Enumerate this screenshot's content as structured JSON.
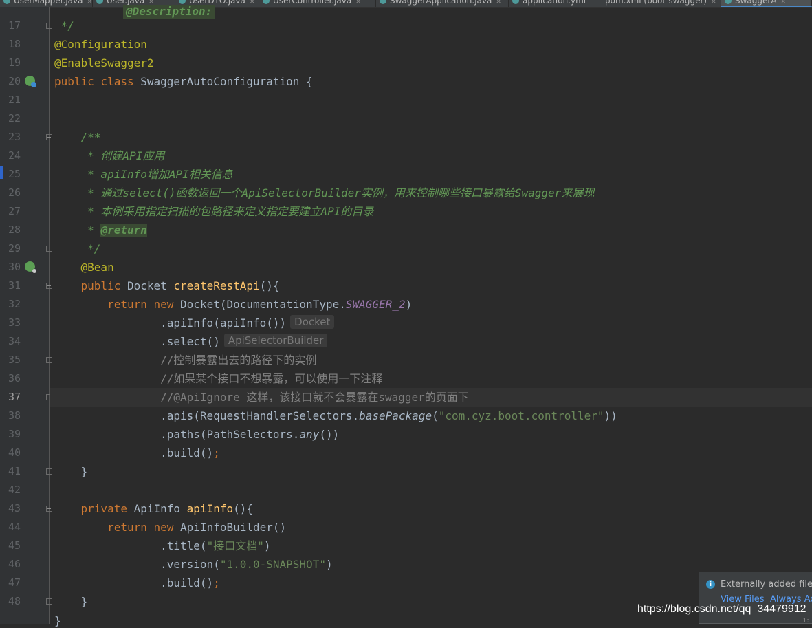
{
  "tabs": [
    {
      "label": "UserMapper.java",
      "icon": "java-class-icon"
    },
    {
      "label": "User.java",
      "icon": "java-class-icon"
    },
    {
      "label": "UserDTO.java",
      "icon": "java-class-icon"
    },
    {
      "label": "UserController.java",
      "icon": "java-class-icon"
    },
    {
      "label": "SwaggerApplication.java",
      "icon": "java-class-icon"
    },
    {
      "label": "application.yml",
      "icon": "yml-file-icon"
    },
    {
      "label": "pom.xml (boot-swagger)",
      "icon": "maven-icon"
    },
    {
      "label": "SwaggerA",
      "icon": "java-class-icon",
      "active": true
    }
  ],
  "top_partial_text": "@Description:",
  "current_line": 37,
  "lines": [
    {
      "n": "17",
      "fold": "end",
      "tokens": [
        {
          "t": " */",
          "c": "c"
        }
      ]
    },
    {
      "n": "18",
      "tokens": [
        {
          "t": "@Configuration",
          "c": "a"
        }
      ]
    },
    {
      "n": "19",
      "tokens": [
        {
          "t": "@EnableSwagger2",
          "c": "a"
        }
      ]
    },
    {
      "n": "20",
      "icon": "spring-config-icon",
      "tokens": [
        {
          "t": "public class ",
          "c": "k"
        },
        {
          "t": "SwaggerAutoConfiguration {"
        }
      ]
    },
    {
      "n": "21",
      "tokens": []
    },
    {
      "n": "22",
      "tokens": []
    },
    {
      "n": "23",
      "fold": "start",
      "tokens": [
        {
          "t": "    /**",
          "c": "c"
        }
      ]
    },
    {
      "n": "24",
      "tokens": [
        {
          "t": "     * 创建API应用",
          "c": "c"
        }
      ]
    },
    {
      "n": "25",
      "tokens": [
        {
          "t": "     * apiInfo增加API相关信息",
          "c": "c"
        }
      ]
    },
    {
      "n": "26",
      "tokens": [
        {
          "t": "     * 通过select()函数返回一个ApiSelectorBuilder实例，用来控制哪些接口暴露给Swagger来展现",
          "c": "c"
        }
      ]
    },
    {
      "n": "27",
      "tokens": [
        {
          "t": "     * 本例采用指定扫描的包路径来定义指定要建立API的目录",
          "c": "c"
        }
      ]
    },
    {
      "n": "28",
      "tokens": [
        {
          "t": "     * ",
          "c": "c"
        },
        {
          "t": "@return",
          "c": "ctag"
        }
      ]
    },
    {
      "n": "29",
      "fold": "end",
      "tokens": [
        {
          "t": "     */",
          "c": "c"
        }
      ]
    },
    {
      "n": "30",
      "icon": "spring-bean-icon",
      "tokens": [
        {
          "t": "    "
        },
        {
          "t": "@Bean",
          "c": "a"
        }
      ]
    },
    {
      "n": "31",
      "fold": "start",
      "tokens": [
        {
          "t": "    "
        },
        {
          "t": "public ",
          "c": "k"
        },
        {
          "t": "Docket "
        },
        {
          "t": "createRestApi",
          "c": "f"
        },
        {
          "t": "(){"
        }
      ]
    },
    {
      "n": "32",
      "tokens": [
        {
          "t": "        "
        },
        {
          "t": "return new ",
          "c": "k"
        },
        {
          "t": "Docket(DocumentationType."
        },
        {
          "t": "SWAGGER_2",
          "c": "sf"
        },
        {
          "t": ")"
        }
      ]
    },
    {
      "n": "33",
      "tokens": [
        {
          "t": "                .apiInfo(apiInfo())"
        },
        {
          "t": "Docket",
          "c": "hint"
        }
      ]
    },
    {
      "n": "34",
      "tokens": [
        {
          "t": "                .select()"
        },
        {
          "t": "ApiSelectorBuilder",
          "c": "hint"
        }
      ]
    },
    {
      "n": "35",
      "fold": "start",
      "tokens": [
        {
          "t": "                //控制暴露出去的路径下的实例",
          "c": "ln"
        }
      ]
    },
    {
      "n": "36",
      "tokens": [
        {
          "t": "                //如果某个接口不想暴露，可以使用一下注释",
          "c": "ln"
        }
      ]
    },
    {
      "n": "37",
      "fold": "end",
      "tokens": [
        {
          "t": "                //@ApiIgnore 这样，该接口就不会暴露在swagger的页面下",
          "c": "ln"
        }
      ]
    },
    {
      "n": "38",
      "tokens": [
        {
          "t": "                .apis(RequestHandlerSelectors."
        },
        {
          "t": "basePackage",
          "c": "it"
        },
        {
          "t": "("
        },
        {
          "t": "\"com.cyz.boot.controller\"",
          "c": "s"
        },
        {
          "t": "))"
        }
      ]
    },
    {
      "n": "39",
      "tokens": [
        {
          "t": "                .paths(PathSelectors."
        },
        {
          "t": "any",
          "c": "it"
        },
        {
          "t": "())"
        }
      ]
    },
    {
      "n": "40",
      "tokens": [
        {
          "t": "                .build()"
        },
        {
          "t": ";",
          "c": "k"
        }
      ]
    },
    {
      "n": "41",
      "fold": "end",
      "tokens": [
        {
          "t": "    }"
        }
      ]
    },
    {
      "n": "42",
      "tokens": []
    },
    {
      "n": "43",
      "fold": "start",
      "tokens": [
        {
          "t": "    "
        },
        {
          "t": "private ",
          "c": "k"
        },
        {
          "t": "ApiInfo "
        },
        {
          "t": "apiInfo",
          "c": "f"
        },
        {
          "t": "(){"
        }
      ]
    },
    {
      "n": "44",
      "tokens": [
        {
          "t": "        "
        },
        {
          "t": "return new ",
          "c": "k"
        },
        {
          "t": "ApiInfoBuilder()"
        }
      ]
    },
    {
      "n": "45",
      "tokens": [
        {
          "t": "                .title("
        },
        {
          "t": "\"接口文档\"",
          "c": "s"
        },
        {
          "t": ")"
        }
      ]
    },
    {
      "n": "46",
      "tokens": [
        {
          "t": "                .version("
        },
        {
          "t": "\"1.0.0-SNAPSHOT\"",
          "c": "s"
        },
        {
          "t": ")"
        }
      ]
    },
    {
      "n": "47",
      "tokens": [
        {
          "t": "                .build()"
        },
        {
          "t": ";",
          "c": "k"
        }
      ]
    },
    {
      "n": "48",
      "fold": "end",
      "tokens": [
        {
          "t": "    }"
        }
      ]
    }
  ],
  "bottom_partial_text": "}",
  "notification": {
    "message": "Externally added files c",
    "view_files_label": "View Files",
    "always_add_label": "Always Ad",
    "icon": "info-icon"
  },
  "watermark": "https://blog.csdn.net/qq_34479912",
  "scroll_indicator": "1:"
}
